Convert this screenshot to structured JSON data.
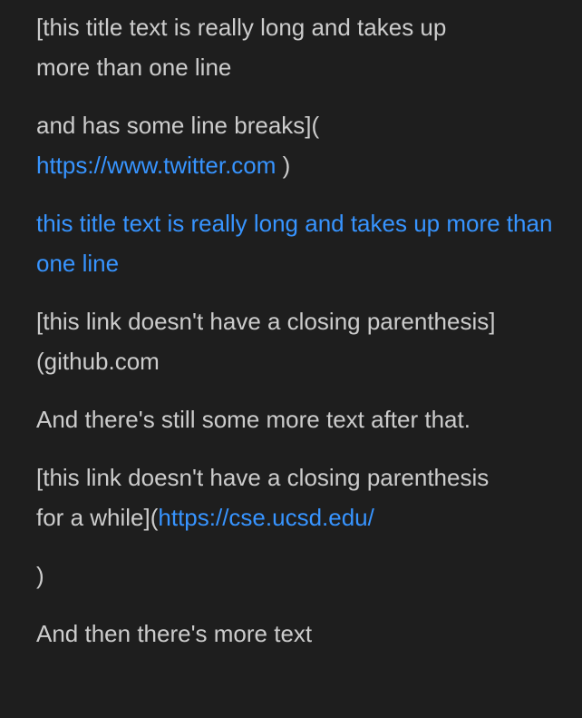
{
  "preview": {
    "p1": {
      "line1": "[this title text is really long and takes up",
      "line2": "more than one line"
    },
    "p2": {
      "text": "and has some line breaks](",
      "link": "https://www.twitter.com",
      "close": " )"
    },
    "p3": {
      "link": "this title text is really long and takes up more than one line"
    },
    "p4": {
      "line1": "[this link doesn't have a closing parenthesis]",
      "line2": "(github.com"
    },
    "p5": {
      "text": "And there's still some more text after that."
    },
    "p6": {
      "line1": "[this link doesn't have a closing parenthesis",
      "prefix": "for a while](",
      "link": "https://cse.ucsd.edu/"
    },
    "p7": {
      "text": ")"
    },
    "p8": {
      "text": "And then there's more text"
    }
  },
  "colors": {
    "background": "#1e1e1e",
    "text": "#cccccc",
    "link": "#3794ff"
  }
}
